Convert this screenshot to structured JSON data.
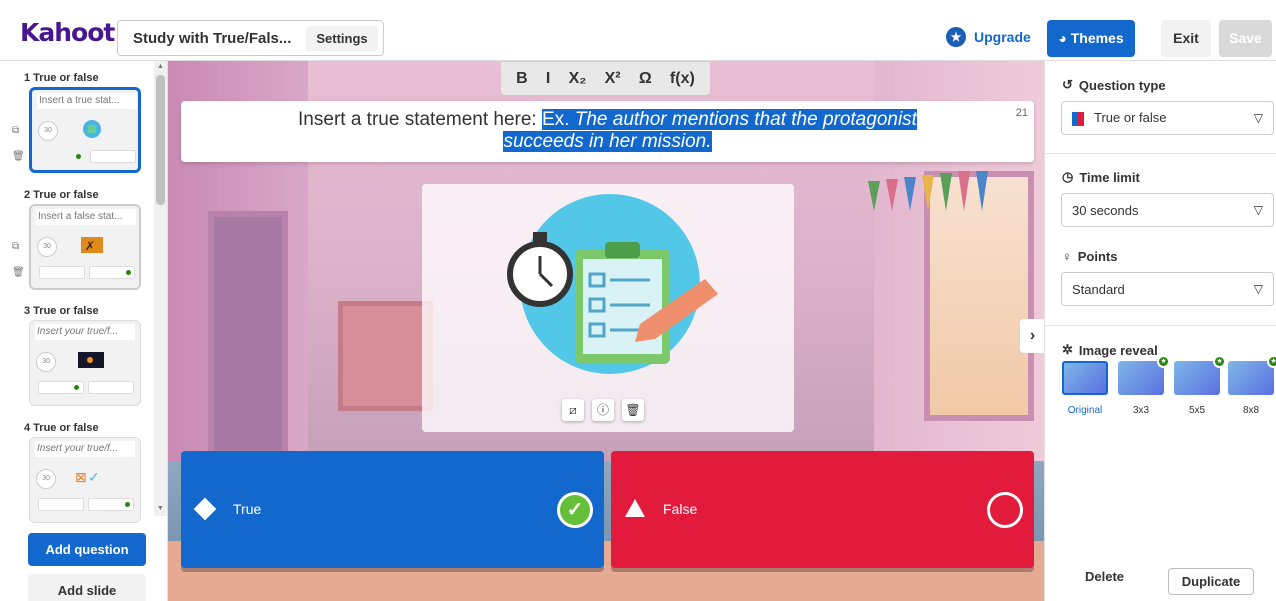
{
  "header": {
    "logo": "Kahoot!",
    "title": "Study with True/Fals...",
    "settings_label": "Settings",
    "upgrade_label": "Upgrade",
    "themes_label": "Themes",
    "exit_label": "Exit",
    "save_label": "Save"
  },
  "sidebar": {
    "questions": [
      {
        "label": "1 True or false",
        "title": "Insert a true stat...",
        "time": "30"
      },
      {
        "label": "2 True or false",
        "title": "Insert a false stat...",
        "time": "30"
      },
      {
        "label": "3 True or false",
        "title": "Insert your true/f...",
        "time": "30"
      },
      {
        "label": "4 True or false",
        "title": "Insert your true/f...",
        "time": "30"
      }
    ],
    "add_question_label": "Add question",
    "add_slide_label": "Add slide"
  },
  "editor": {
    "toolbar": [
      "B",
      "I",
      "X₂",
      "X²",
      "Ω",
      "f(x)"
    ],
    "question_prefix": "Insert a true statement here: ",
    "question_highlight_ex": "Ex. ",
    "question_highlight_italic_1": "The author mentions that the protagonist",
    "question_highlight_italic_2": "succeeds in her mission.",
    "char_counter": "21",
    "answers": [
      {
        "label": "True",
        "color": "#1368ce",
        "correct": true
      },
      {
        "label": "False",
        "color": "#e21b3c",
        "correct": false
      }
    ]
  },
  "panel": {
    "question_type_title": "Question type",
    "question_type_value": "True or false",
    "time_limit_title": "Time limit",
    "time_limit_value": "30 seconds",
    "points_title": "Points",
    "points_value": "Standard",
    "image_reveal_title": "Image reveal",
    "reveal_options": [
      "Original",
      "3x3",
      "5x5",
      "8x8"
    ],
    "delete_label": "Delete",
    "duplicate_label": "Duplicate"
  }
}
